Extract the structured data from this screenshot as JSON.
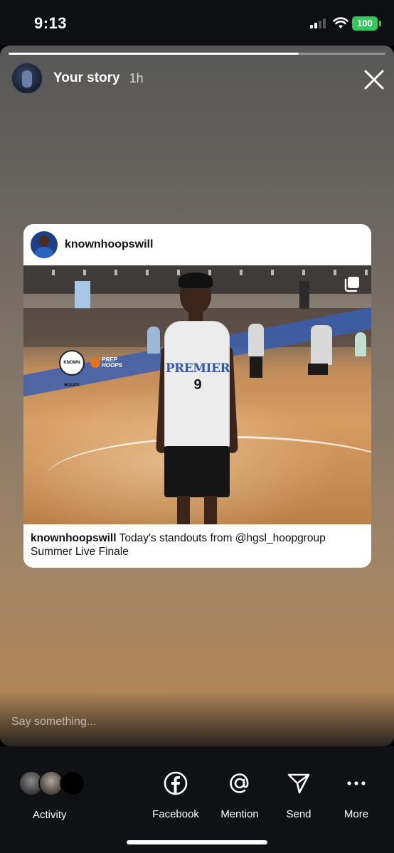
{
  "status_bar": {
    "time": "9:13",
    "battery": "100",
    "battery_color": "#34c759"
  },
  "story": {
    "progress": 0.77,
    "user_name": "Your story",
    "time_ago": "1h",
    "close_icon": "close-icon",
    "comment_placeholder": "Say something..."
  },
  "shared_post": {
    "username": "knownhoopswill",
    "caption_user": "knownhoopswill",
    "caption_text": " Today's standouts from @hgsl_hoopgroup Summer Live Finale",
    "image_text": {
      "jersey_name": "PREMIER",
      "jersey_number": "9",
      "logo_known_hoops": "KNOWN HOOPS",
      "logo_prep_hoops_1": "PREP",
      "logo_prep_hoops_2": "HOOPS"
    },
    "multi_icon": "carousel-icon"
  },
  "actions": {
    "activity": {
      "label": "Activity"
    },
    "facebook": {
      "label": "Facebook",
      "icon": "facebook-icon"
    },
    "mention": {
      "label": "Mention",
      "icon": "at-icon"
    },
    "send": {
      "label": "Send",
      "icon": "send-icon"
    },
    "more": {
      "label": "More",
      "icon": "more-icon"
    }
  }
}
